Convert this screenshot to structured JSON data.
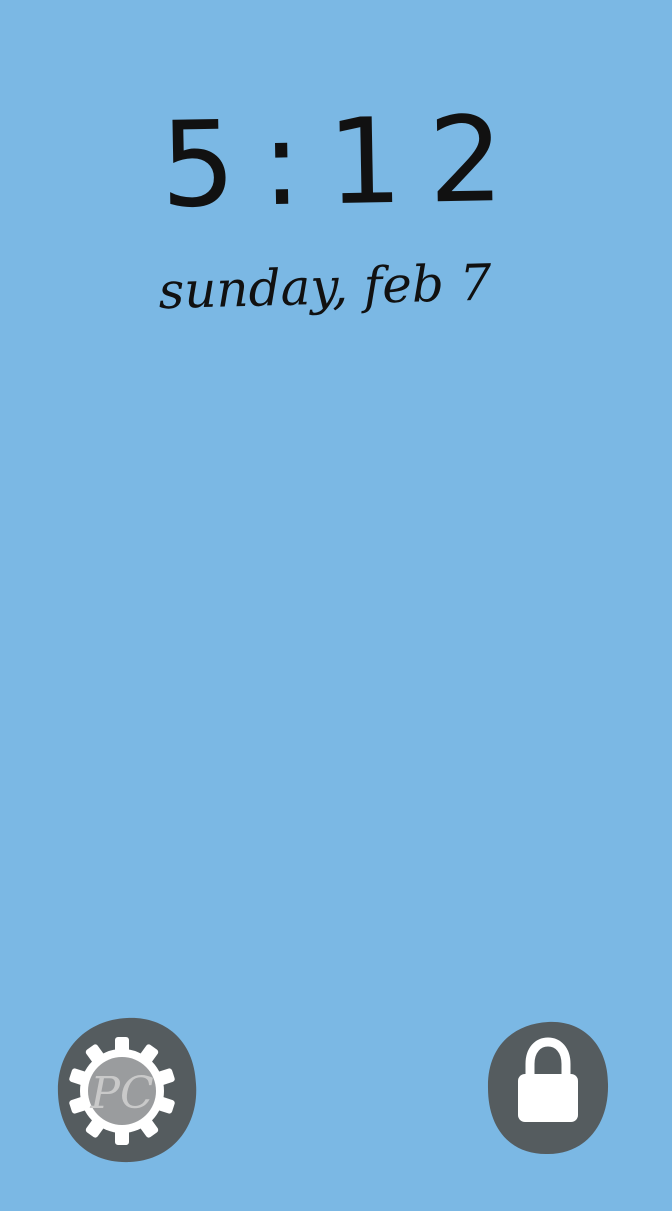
{
  "lockscreen": {
    "time": "5:12",
    "date": "sunday, feb 7"
  },
  "buttons": {
    "settings": {
      "icon": "gear-icon",
      "overlay_text": "PC"
    },
    "lock": {
      "icon": "lock-icon"
    }
  },
  "colors": {
    "background": "#7bb8e4",
    "text": "#111111",
    "button_bg": "#555c5f",
    "icon": "#ffffff"
  }
}
